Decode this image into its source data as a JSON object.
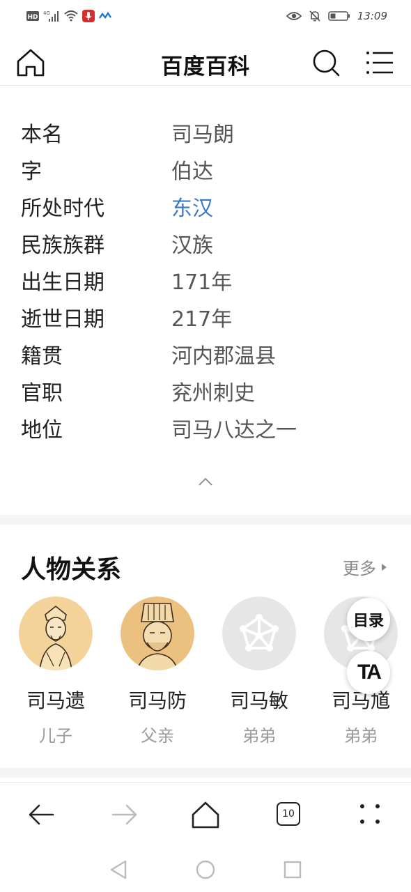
{
  "status_bar": {
    "left_icons": [
      "hd-icon",
      "signal-4g-icon",
      "wifi-icon",
      "voice-recorder-icon",
      "app-notification-icon"
    ],
    "network_label": "4G",
    "right_icons": [
      "eye-icon",
      "mute-bell-icon",
      "battery-icon"
    ],
    "time": "13:09"
  },
  "header": {
    "title": "百度百科",
    "home_icon": "home-icon",
    "search_icon": "search-icon",
    "menu_icon": "menu-icon"
  },
  "basic_info": [
    {
      "key": "本名",
      "value": "司马朗"
    },
    {
      "key": "字",
      "value": "伯达"
    },
    {
      "key": "所处时代",
      "value": "东汉",
      "link": true
    },
    {
      "key": "民族族群",
      "value": "汉族"
    },
    {
      "key": "出生日期",
      "value": "171年"
    },
    {
      "key": "逝世日期",
      "value": "217年"
    },
    {
      "key": "籍贯",
      "value": "河内郡温县"
    },
    {
      "key": "官职",
      "value": "兖州刺史"
    },
    {
      "key": "地位",
      "value": "司马八达之一"
    }
  ],
  "relations": {
    "title": "人物关系",
    "more_label": "更多",
    "people": [
      {
        "name": "司马遗",
        "relation": "儿子"
      },
      {
        "name": "司马防",
        "relation": "父亲"
      },
      {
        "name": "司马敏",
        "relation": "弟弟"
      },
      {
        "name": "司马馗",
        "relation": "弟弟"
      }
    ]
  },
  "floating": {
    "toc_label": "目录",
    "ta_label": "TA"
  },
  "tabs_count": "10",
  "colors": {
    "link": "#3a7bc8",
    "separator": "#f4f4f4",
    "avatar_bg": "#f3d39a",
    "placeholder_bg": "#e6e6e6"
  }
}
